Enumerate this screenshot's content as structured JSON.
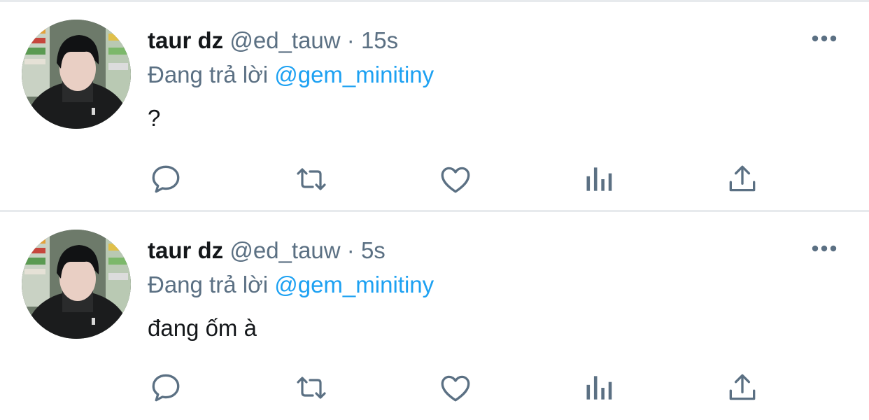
{
  "tweets": [
    {
      "display_name": "taur dz",
      "handle": "@ed_tauw",
      "separator": "·",
      "time": "15s",
      "reply_prefix": "Đang trả lời",
      "reply_to": "@gem_minitiny",
      "text": "?"
    },
    {
      "display_name": "taur dz",
      "handle": "@ed_tauw",
      "separator": "·",
      "time": "5s",
      "reply_prefix": "Đang trả lời",
      "reply_to": "@gem_minitiny",
      "text": "đang ốm à"
    }
  ],
  "icons": {
    "actions": [
      "reply-icon",
      "retweet-icon",
      "like-icon",
      "analytics-icon",
      "share-icon"
    ],
    "more": "more-dots-icon"
  },
  "colors": {
    "name": "#14171a",
    "secondary": "#5b7083",
    "mention": "#1da1f2",
    "icon": "#5b7083",
    "divider": "#e7eaed"
  }
}
